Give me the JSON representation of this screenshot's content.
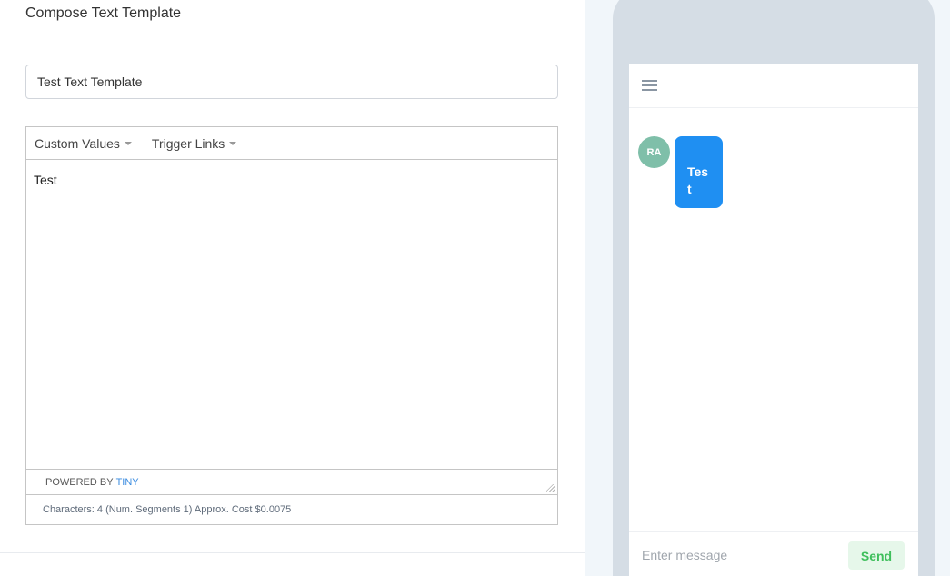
{
  "header": {
    "title": "Compose Text Template"
  },
  "template_name": {
    "value": "Test Text Template"
  },
  "editor": {
    "menus": [
      {
        "label": "Custom Values"
      },
      {
        "label": "Trigger Links"
      }
    ],
    "content": "Test",
    "powered_by": "POWERED BY",
    "tiny": "TINY",
    "stats": "Characters: 4 (Num. Segments 1) Approx. Cost $0.0075"
  },
  "preview": {
    "avatar_initials": "RA",
    "message": "Test",
    "input_placeholder": "Enter message",
    "send_label": "Send"
  },
  "colors": {
    "bubble": "#1f8ff2",
    "avatar": "#7fbfa9",
    "send_text": "#3fbf5c",
    "tiny_link": "#3b8ce0"
  }
}
